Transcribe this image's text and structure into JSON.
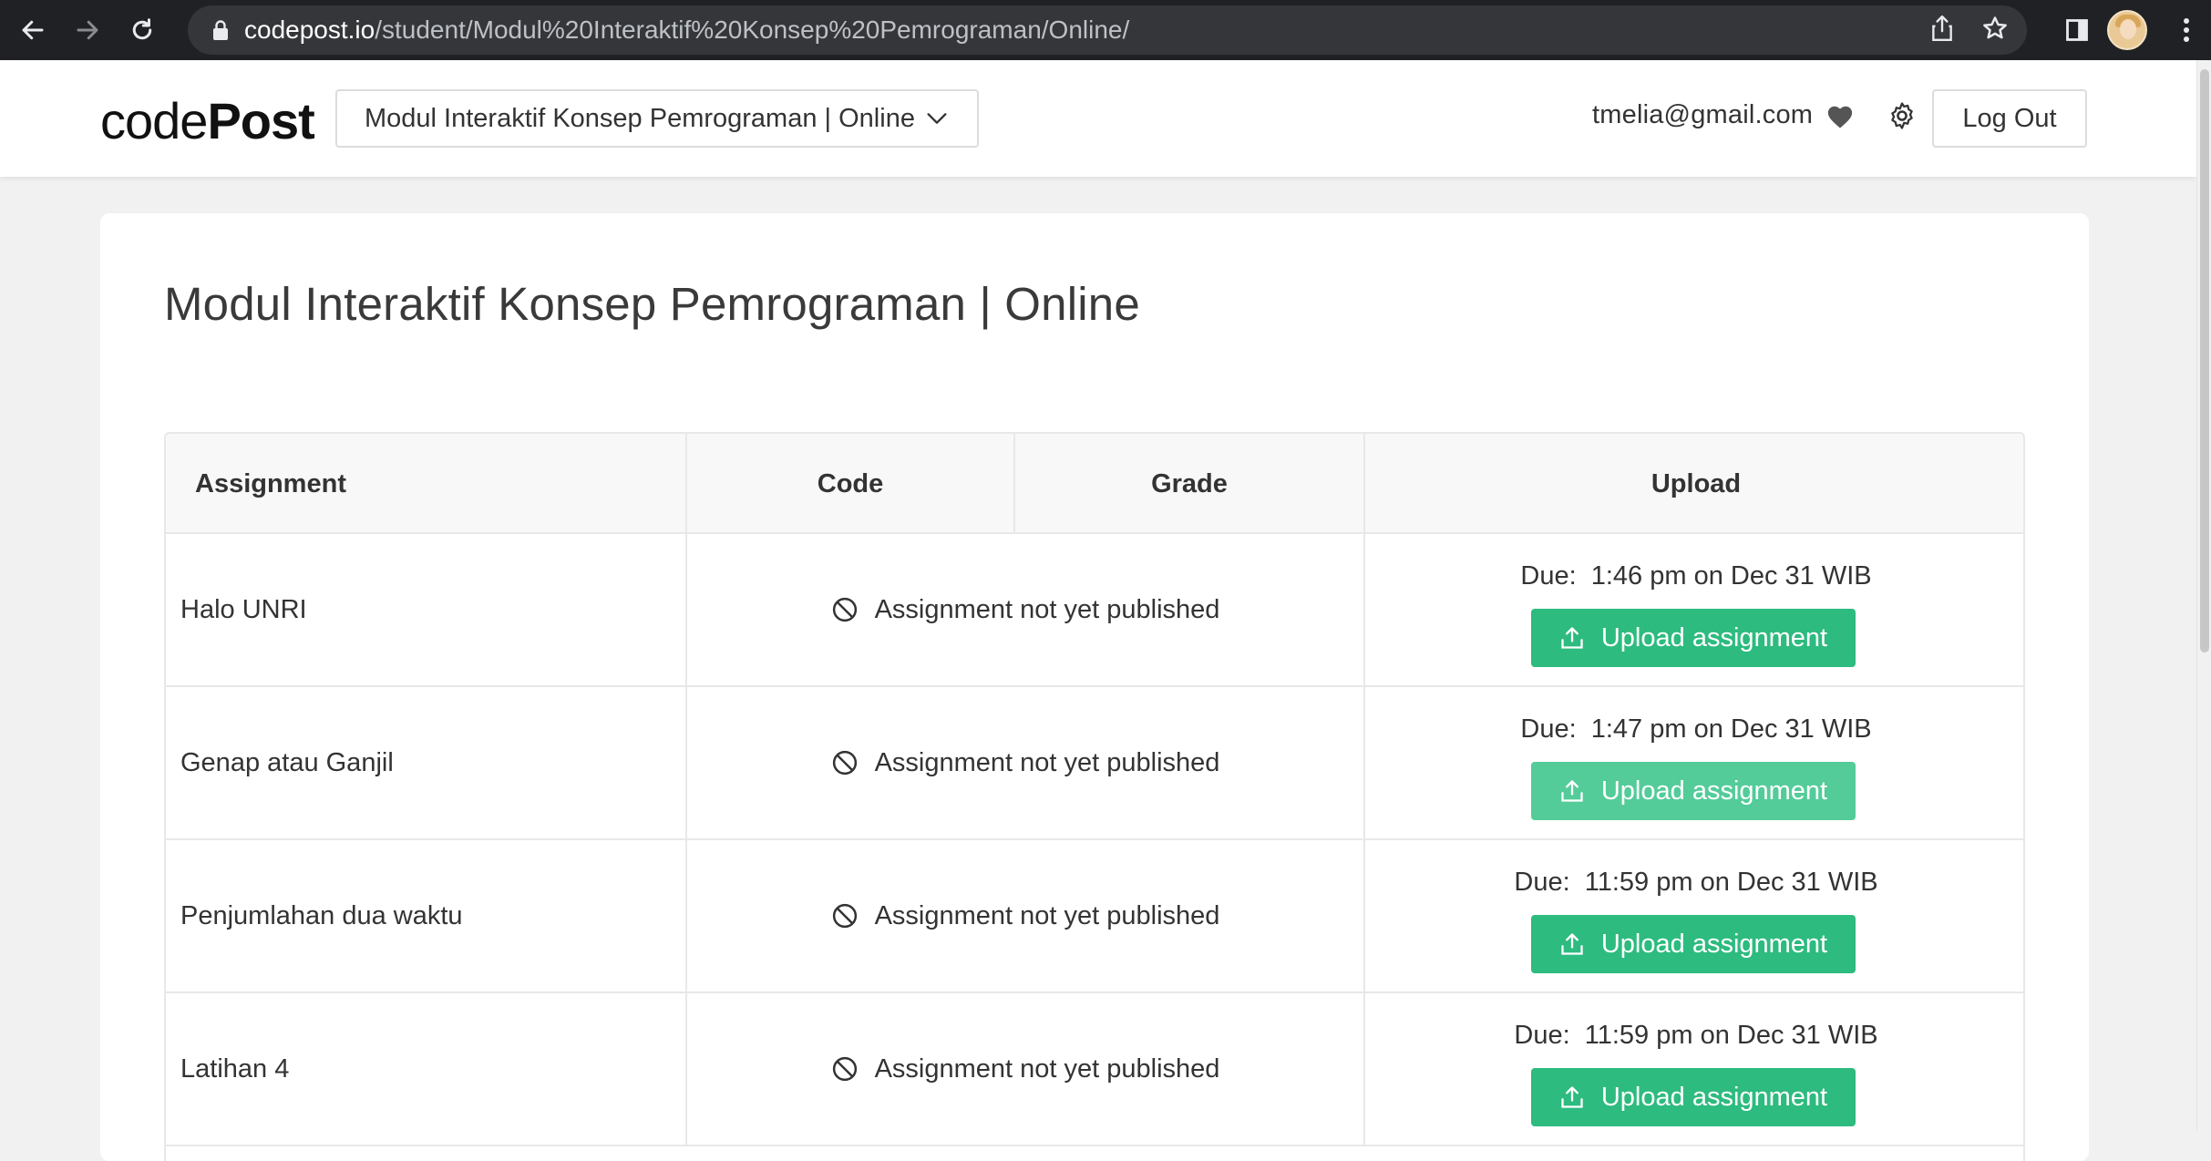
{
  "browser": {
    "url_host": "codepost.io",
    "url_path": "/student/Modul%20Interaktif%20Konsep%20Pemrograman/Online/"
  },
  "header": {
    "logo_light": "code",
    "logo_bold": "Post",
    "course_selector": "Modul Interaktif Konsep Pemrograman | Online",
    "user_email": "tmelia@gmail.com",
    "logout_label": "Log Out"
  },
  "main": {
    "title": "Modul Interaktif Konsep Pemrograman | Online",
    "table": {
      "headers": {
        "assignment": "Assignment",
        "code": "Code",
        "grade": "Grade",
        "upload": "Upload"
      },
      "rows": [
        {
          "name": "Halo UNRI",
          "status": "Assignment not yet published",
          "due": "Due:  1:46 pm on Dec 31 WIB",
          "button": "Upload assignment"
        },
        {
          "name": "Genap atau Ganjil",
          "status": "Assignment not yet published",
          "due": "Due:  1:47 pm on Dec 31 WIB",
          "button": "Upload assignment"
        },
        {
          "name": "Penjumlahan dua waktu",
          "status": "Assignment not yet published",
          "due": "Due:  11:59 pm on Dec 31 WIB",
          "button": "Upload assignment"
        },
        {
          "name": "Latihan 4",
          "status": "Assignment not yet published",
          "due": "Due:  11:59 pm on Dec 31 WIB",
          "button": "Upload assignment"
        }
      ]
    }
  },
  "colors": {
    "accent_green": "#2dbb7f",
    "accent_green_hover": "#53cc99",
    "chrome_bg": "#202124"
  }
}
